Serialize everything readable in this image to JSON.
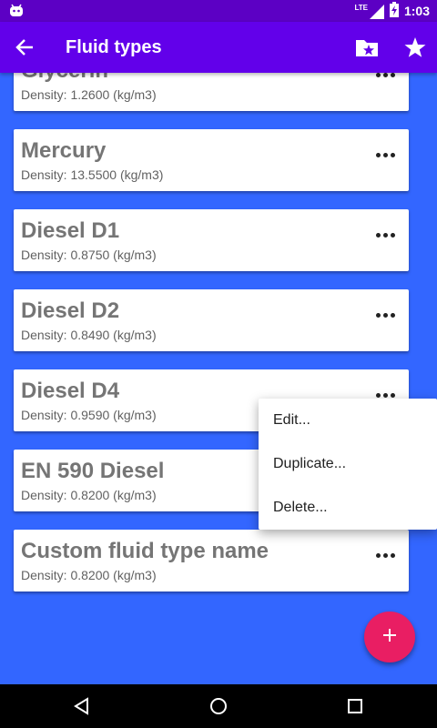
{
  "status_bar": {
    "network": "LTE",
    "time": "1:03"
  },
  "toolbar": {
    "title": "Fluid types",
    "back_icon": "arrow-left-icon",
    "folder_icon": "folder-star-icon",
    "star_icon": "star-icon"
  },
  "fluids": [
    {
      "name": "Glycerin",
      "density": "Density: 1.2600 (kg/m3)"
    },
    {
      "name": "Mercury",
      "density": "Density: 13.5500 (kg/m3)"
    },
    {
      "name": "Diesel D1",
      "density": "Density: 0.8750 (kg/m3)"
    },
    {
      "name": "Diesel D2",
      "density": "Density: 0.8490 (kg/m3)"
    },
    {
      "name": "Diesel D4",
      "density": "Density: 0.9590 (kg/m3)"
    },
    {
      "name": "EN 590 Diesel",
      "density": "Density: 0.8200 (kg/m3)"
    },
    {
      "name": "Custom fluid type name",
      "density": "Density: 0.8200 (kg/m3)"
    }
  ],
  "context_menu": {
    "items": [
      "Edit...",
      "Duplicate...",
      "Delete..."
    ]
  },
  "fab": {
    "icon": "plus-icon"
  },
  "colors": {
    "status_bar": "#5c00c4",
    "toolbar": "#6200ea",
    "background": "#3366ff",
    "fab": "#e91e63"
  }
}
